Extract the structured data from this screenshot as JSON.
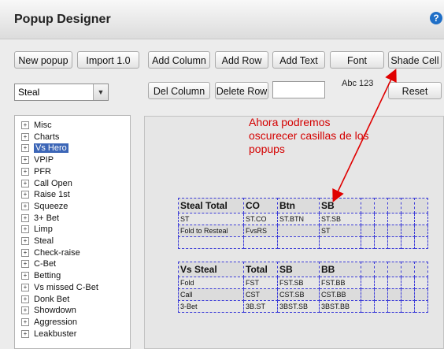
{
  "window": {
    "title": "Popup Designer",
    "help_icon": "?"
  },
  "toolbar_row1": {
    "new_popup": "New popup",
    "import": "Import 1.0",
    "add_column": "Add Column",
    "add_row": "Add Row",
    "add_text": "Add Text",
    "font": "Font",
    "shade_cell": "Shade Cell"
  },
  "toolbar_row2": {
    "del_column": "Del Column",
    "delete_row": "Delete Row",
    "text_value": "",
    "sample_text": "Abc 123",
    "reset": "Reset"
  },
  "stat_dropdown": {
    "selected": "Steal"
  },
  "tree": {
    "items": [
      {
        "label": "Misc"
      },
      {
        "label": "Charts"
      },
      {
        "label": "Vs Hero",
        "selected": true
      },
      {
        "label": "VPIP"
      },
      {
        "label": "PFR"
      },
      {
        "label": "Call Open"
      },
      {
        "label": "Raise 1st"
      },
      {
        "label": "Squeeze"
      },
      {
        "label": "3+ Bet"
      },
      {
        "label": "Limp"
      },
      {
        "label": "Steal"
      },
      {
        "label": "Check-raise"
      },
      {
        "label": "C-Bet"
      },
      {
        "label": "Betting"
      },
      {
        "label": "Vs missed C-Bet"
      },
      {
        "label": "Donk Bet"
      },
      {
        "label": "Showdown"
      },
      {
        "label": "Aggression"
      },
      {
        "label": "Leakbuster"
      }
    ]
  },
  "annotation": {
    "text": "Ahora podremos oscurecer casillas de los popups",
    "color": "#d40000"
  },
  "table1": {
    "header": [
      "Steal Total",
      "CO",
      "Btn",
      "SB",
      "",
      "",
      "",
      "",
      ""
    ],
    "rows": [
      [
        "ST",
        "ST.CO",
        "ST.BTN",
        "ST.SB",
        "",
        "",
        "",
        "",
        ""
      ],
      [
        "Fold to Resteal",
        "FvsRS",
        "",
        "ST",
        "",
        "",
        "",
        "",
        ""
      ],
      [
        "",
        "",
        "",
        "",
        "",
        "",
        "",
        "",
        ""
      ]
    ]
  },
  "table2": {
    "header": [
      "Vs Steal",
      "Total",
      "SB",
      "BB",
      "",
      "",
      "",
      "",
      ""
    ],
    "rows": [
      [
        "Fold",
        "FST",
        "FST.SB",
        "FST.BB",
        "",
        "",
        "",
        "",
        ""
      ],
      [
        "Call",
        "CST",
        "CST.SB",
        "CST.BB",
        "",
        "",
        "",
        "",
        ""
      ],
      [
        "3-Bet",
        "3B.ST",
        "3BST.SB",
        "3BST.BB",
        "",
        "",
        "",
        "",
        ""
      ]
    ]
  }
}
